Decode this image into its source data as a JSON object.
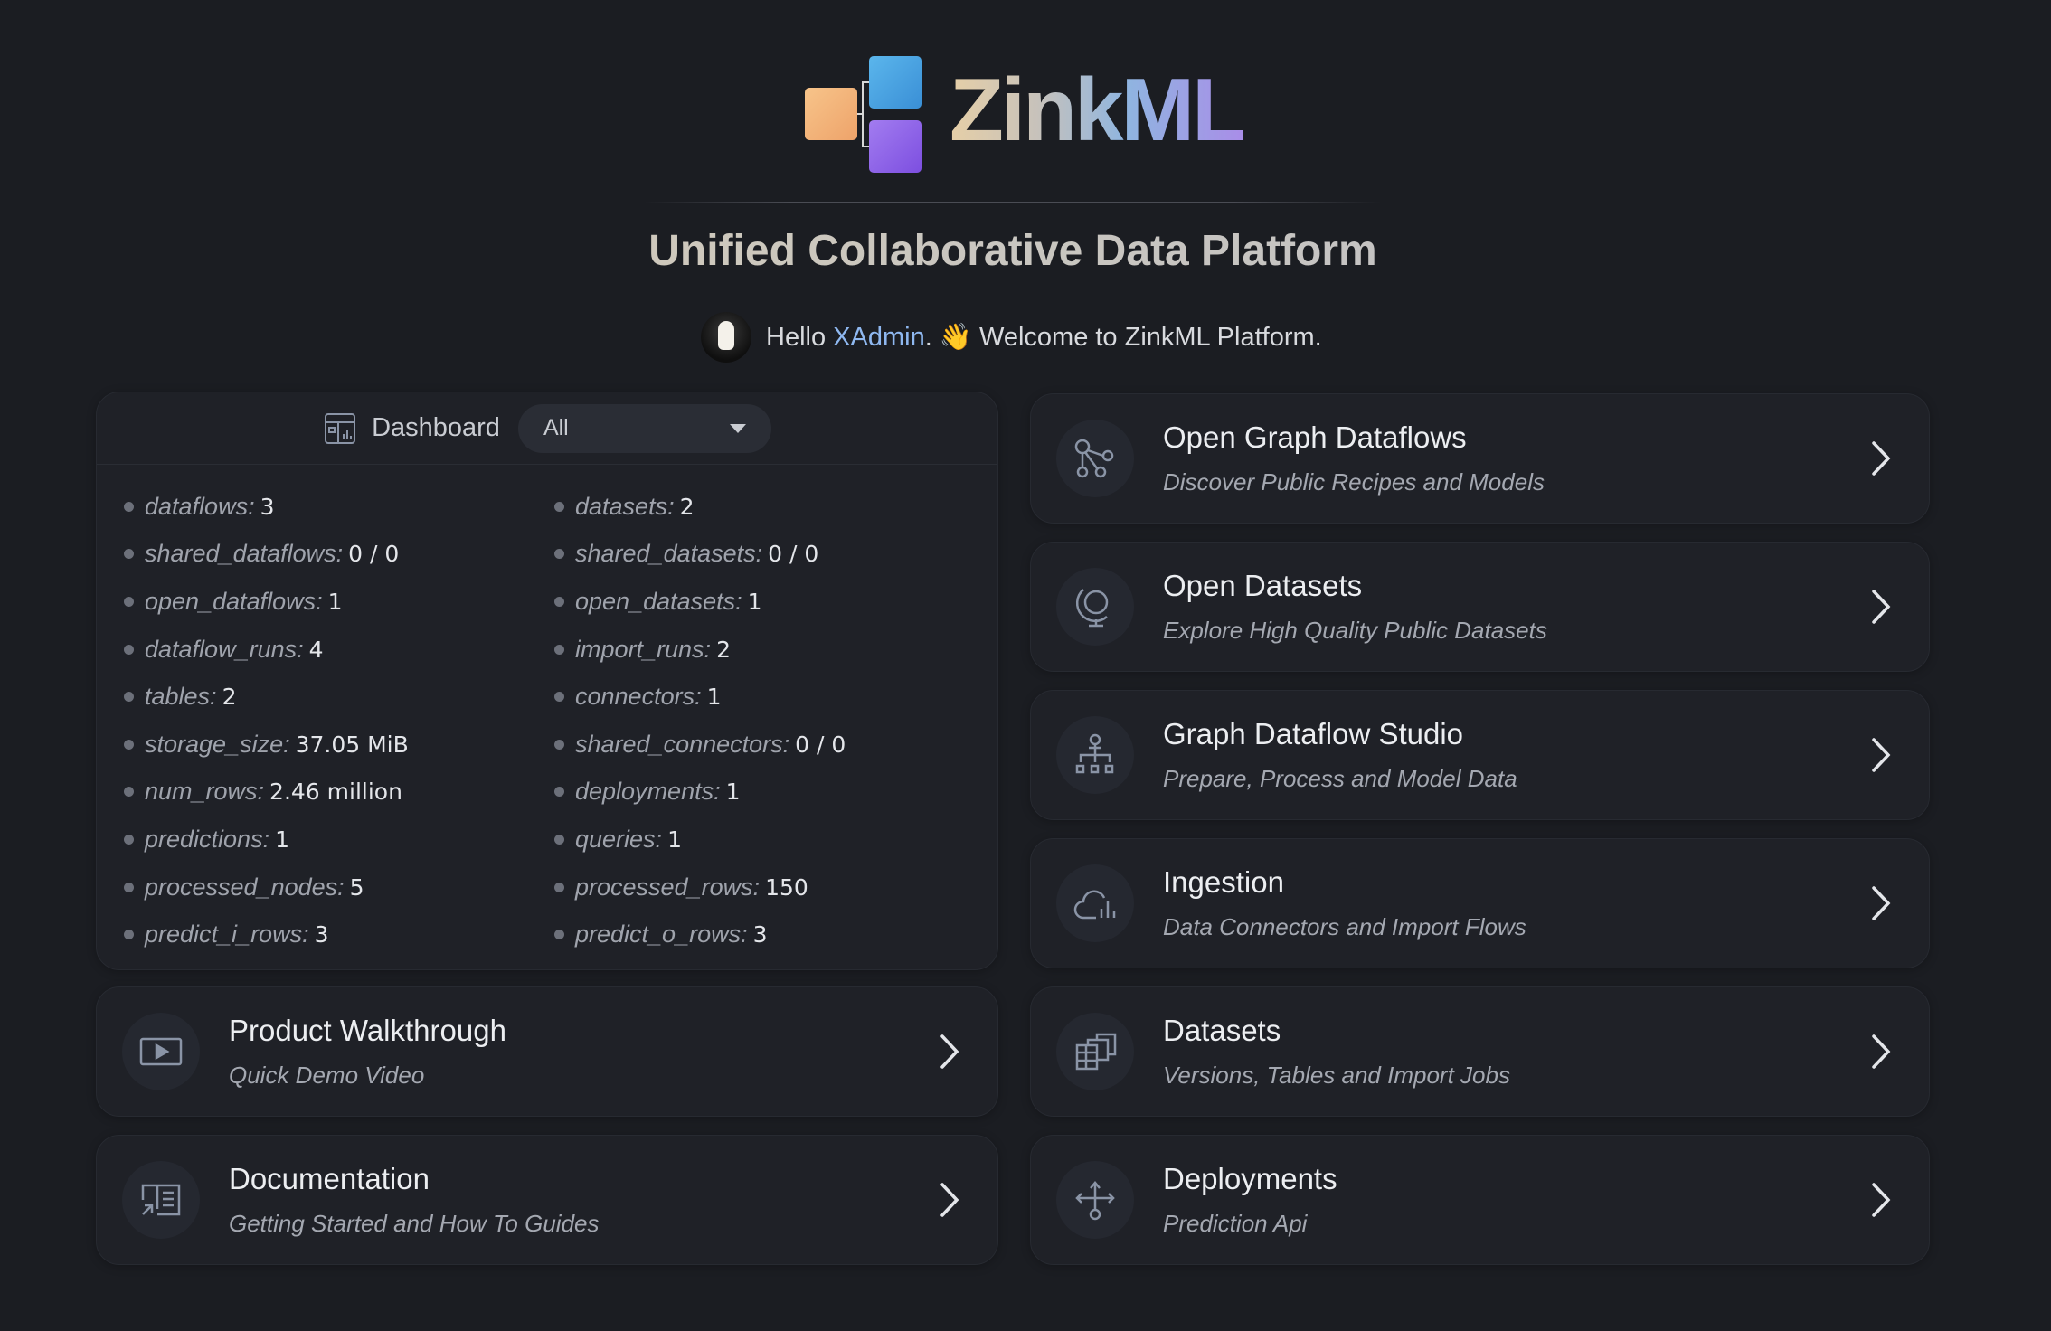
{
  "brand": {
    "name": "ZinkML",
    "tagline": "Unified Collaborative Data Platform"
  },
  "welcome": {
    "hello": "Hello ",
    "user": "XAdmin",
    "message": ". 👋 Welcome to ZinkML Platform."
  },
  "dashboard": {
    "title": "Dashboard",
    "filter": "All",
    "stats_left": [
      {
        "key": "dataflows:",
        "value": "3"
      },
      {
        "key": "shared_dataflows:",
        "value": "0 / 0"
      },
      {
        "key": "open_dataflows:",
        "value": "1"
      },
      {
        "key": "dataflow_runs:",
        "value": "4"
      },
      {
        "key": "tables:",
        "value": "2"
      },
      {
        "key": "storage_size:",
        "value": "37.05 MiB"
      },
      {
        "key": "num_rows:",
        "value": "2.46 million"
      },
      {
        "key": "predictions:",
        "value": "1"
      },
      {
        "key": "processed_nodes:",
        "value": "5"
      },
      {
        "key": "predict_i_rows:",
        "value": "3"
      }
    ],
    "stats_right": [
      {
        "key": "datasets:",
        "value": "2"
      },
      {
        "key": "shared_datasets:",
        "value": "0 / 0"
      },
      {
        "key": "open_datasets:",
        "value": "1"
      },
      {
        "key": "import_runs:",
        "value": "2"
      },
      {
        "key": "connectors:",
        "value": "1"
      },
      {
        "key": "shared_connectors:",
        "value": "0 / 0"
      },
      {
        "key": "deployments:",
        "value": "1"
      },
      {
        "key": "queries:",
        "value": "1"
      },
      {
        "key": "processed_rows:",
        "value": "150"
      },
      {
        "key": "predict_o_rows:",
        "value": "3"
      }
    ]
  },
  "left_links": [
    {
      "title": "Product Walkthrough",
      "subtitle": "Quick Demo Video",
      "icon": "video-play-icon"
    },
    {
      "title": "Documentation",
      "subtitle": "Getting Started and How To Guides",
      "icon": "book-icon"
    }
  ],
  "right_links": [
    {
      "title": "Open Graph Dataflows",
      "subtitle": "Discover Public Recipes and Models",
      "icon": "graph-nodes-icon"
    },
    {
      "title": "Open Datasets",
      "subtitle": "Explore High Quality Public Datasets",
      "icon": "globe-icon"
    },
    {
      "title": "Graph Dataflow Studio",
      "subtitle": "Prepare, Process and Model Data",
      "icon": "hierarchy-icon"
    },
    {
      "title": "Ingestion",
      "subtitle": "Data Connectors and Import Flows",
      "icon": "cloud-chart-icon"
    },
    {
      "title": "Datasets",
      "subtitle": "Versions, Tables and Import Jobs",
      "icon": "table-stack-icon"
    },
    {
      "title": "Deployments",
      "subtitle": "Prediction Api",
      "icon": "arrows-split-icon"
    }
  ],
  "colors": {
    "background": "#1b1d22",
    "card": "#1f2127",
    "accent_user": "#8fb8f0",
    "icon": "#8a94a6"
  }
}
